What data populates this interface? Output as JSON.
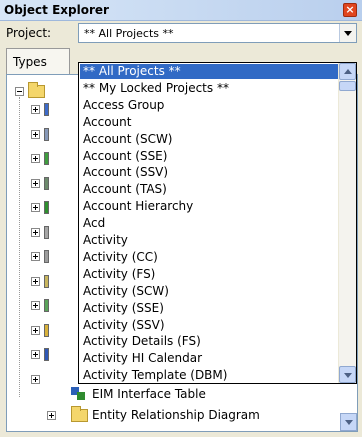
{
  "window": {
    "title": "Object Explorer"
  },
  "project": {
    "label": "Project:",
    "selected": "** All Projects **"
  },
  "tabs": {
    "types_label": "Types"
  },
  "dropdown": {
    "items": [
      {
        "label": "** All Projects **",
        "selected": true
      },
      {
        "label": "** My Locked Projects **",
        "selected": false
      },
      {
        "label": "Access Group",
        "selected": false
      },
      {
        "label": "Account",
        "selected": false
      },
      {
        "label": "Account (SCW)",
        "selected": false
      },
      {
        "label": "Account (SSE)",
        "selected": false
      },
      {
        "label": "Account (SSV)",
        "selected": false
      },
      {
        "label": "Account (TAS)",
        "selected": false
      },
      {
        "label": "Account Hierarchy",
        "selected": false
      },
      {
        "label": "Acd",
        "selected": false
      },
      {
        "label": "Activity",
        "selected": false
      },
      {
        "label": "Activity (CC)",
        "selected": false
      },
      {
        "label": "Activity (FS)",
        "selected": false
      },
      {
        "label": "Activity (SCW)",
        "selected": false
      },
      {
        "label": "Activity (SSE)",
        "selected": false
      },
      {
        "label": "Activity (SSV)",
        "selected": false
      },
      {
        "label": "Activity Details (FS)",
        "selected": false
      },
      {
        "label": "Activity HI Calendar",
        "selected": false
      },
      {
        "label": "Activity Template (DBM)",
        "selected": false
      }
    ]
  },
  "tree": {
    "visible_items": [
      {
        "label": "EIM Interface Table",
        "icon": "table-icon"
      },
      {
        "label": "Entity Relationship Diagram",
        "icon": "folder-icon"
      }
    ]
  },
  "colors": {
    "selection": "#316ac5",
    "close": "#e0461e"
  }
}
